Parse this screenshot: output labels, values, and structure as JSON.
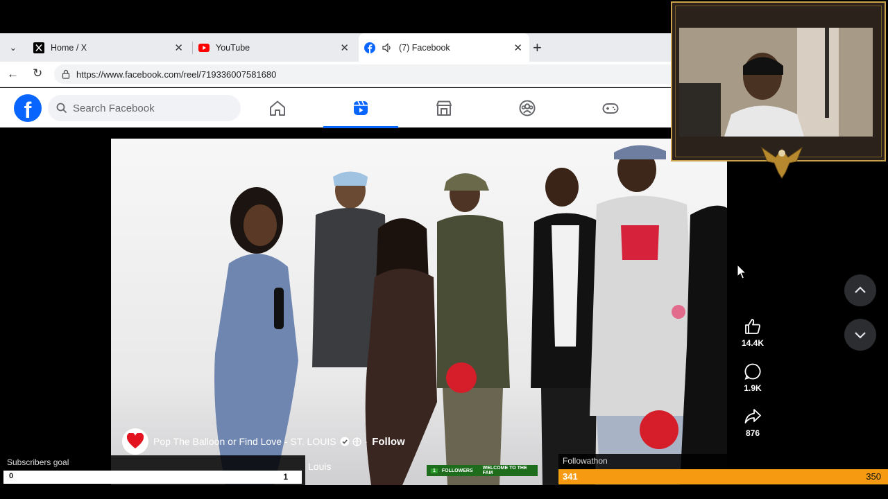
{
  "browser": {
    "tabs": [
      {
        "label": "Home / X",
        "icon": "x-logo-icon"
      },
      {
        "label": "YouTube",
        "icon": "youtube-icon"
      },
      {
        "label": "(7) Facebook",
        "icon": "facebook-icon",
        "active": true
      }
    ],
    "url": "https://www.facebook.com/reel/719336007581680"
  },
  "facebook": {
    "search_placeholder": "Search Facebook",
    "nav": [
      "home-icon",
      "reels-icon",
      "marketplace-icon",
      "groups-icon",
      "gaming-icon"
    ],
    "brand_color": "#0866ff"
  },
  "reel": {
    "page_name": "Pop The Balloon or Find Love - ST. LOUIS",
    "follow_label": "Follow",
    "caption_line2": "Louis",
    "likes": "14.4K",
    "comments": "1.9K",
    "shares": "876"
  },
  "overlays": {
    "subscribers_goal": {
      "title": "Subscribers goal",
      "current": "0",
      "target": "1"
    },
    "followathon": {
      "title": "Followathon",
      "current": "341",
      "target": "350",
      "color": "#f59a11"
    },
    "ticker": {
      "count": "1",
      "label1": "FOLLOWERS",
      "label2": "WELCOME TO THE FAM"
    }
  }
}
